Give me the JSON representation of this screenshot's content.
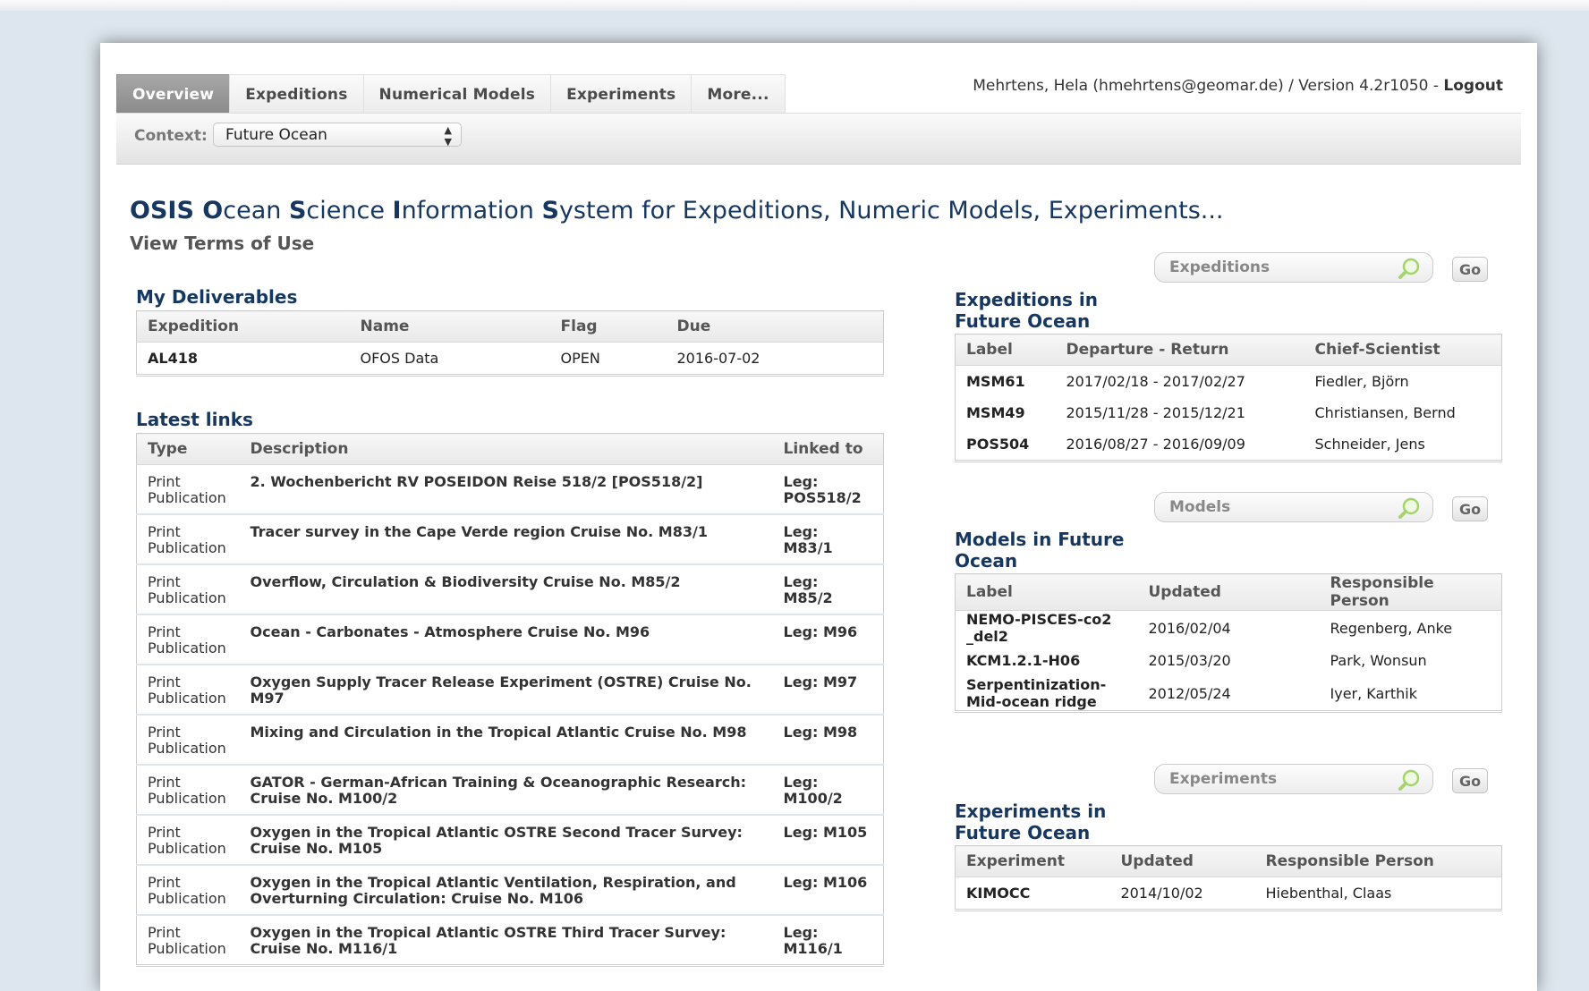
{
  "tabs": [
    "Overview",
    "Expeditions",
    "Numerical Models",
    "Experiments",
    "More..."
  ],
  "active_tab": "Overview",
  "user_info": {
    "text": "Mehrtens, Hela (hmehrtens@geomar.de) / Version 4.2r1050 - ",
    "logout": "Logout"
  },
  "context": {
    "label": "Context:",
    "value": "Future Ocean"
  },
  "title": {
    "parts": [
      {
        "t": "O",
        "b": true
      },
      {
        "t": "SIS ",
        "b": true
      },
      {
        "t": "O",
        "b": true
      },
      {
        "t": "cean ",
        "b": false
      },
      {
        "t": "S",
        "b": true
      },
      {
        "t": "cience ",
        "b": false
      },
      {
        "t": "I",
        "b": true
      },
      {
        "t": "nformation ",
        "b": false
      },
      {
        "t": "S",
        "b": true
      },
      {
        "t": "ystem for Expeditions, Numeric Models, Experiments...",
        "b": false
      }
    ]
  },
  "terms_link": "View Terms of Use",
  "deliverables": {
    "title": "My Deliverables",
    "headers": [
      "Expedition",
      "Name",
      "Flag",
      "Due"
    ],
    "rows": [
      {
        "expedition": "AL418",
        "name": "OFOS Data",
        "flag": "OPEN",
        "due": "2016-07-02"
      }
    ]
  },
  "latest_links": {
    "title": "Latest links",
    "headers": [
      "Type",
      "Description",
      "Linked to"
    ],
    "rows": [
      {
        "type": "Print Publication",
        "desc": "2. Wochenbericht RV POSEIDON Reise 518/2 [POS518/2]",
        "leg": "Leg: POS518/2"
      },
      {
        "type": "Print Publication",
        "desc": "Tracer survey in the Cape Verde region Cruise No. M83/1",
        "leg": "Leg: M83/1"
      },
      {
        "type": "Print Publication",
        "desc": "Overflow, Circulation & Biodiversity Cruise No. M85/2",
        "leg": "Leg: M85/2"
      },
      {
        "type": "Print Publication",
        "desc": "Ocean - Carbonates - Atmosphere Cruise No. M96",
        "leg": "Leg: M96"
      },
      {
        "type": "Print Publication",
        "desc": "Oxygen Supply Tracer Release Experiment (OSTRE) Cruise No. M97",
        "leg": "Leg: M97"
      },
      {
        "type": "Print Publication",
        "desc": "Mixing and Circulation in the Tropical Atlantic Cruise No. M98",
        "leg": "Leg: M98"
      },
      {
        "type": "Print Publication",
        "desc": "GATOR - German-African Training & Oceanographic Research: Cruise No. M100/2",
        "leg": "Leg: M100/2"
      },
      {
        "type": "Print Publication",
        "desc": "Oxygen in the Tropical Atlantic OSTRE Second Tracer Survey: Cruise No. M105",
        "leg": "Leg: M105"
      },
      {
        "type": "Print Publication",
        "desc": "Oxygen in the Tropical Atlantic Ventilation, Respiration, and Overturning Circulation: Cruise No. M106",
        "leg": "Leg: M106"
      },
      {
        "type": "Print Publication",
        "desc": "Oxygen in the Tropical Atlantic OSTRE Third Tracer Survey: Cruise No. M116/1",
        "leg": "Leg: M116/1"
      }
    ]
  },
  "search": {
    "expeditions_placeholder": "Expeditions",
    "models_placeholder": "Models",
    "experiments_placeholder": "Experiments",
    "go_label": "Go"
  },
  "expeditions": {
    "title_line1": "Expeditions in",
    "title_line2": "Future Ocean",
    "headers": [
      "Label",
      "Departure - Return",
      "Chief-Scientist"
    ],
    "rows": [
      {
        "label": "MSM61",
        "dates": "2017/02/18 - 2017/02/27",
        "chief": "Fiedler, Björn"
      },
      {
        "label": "MSM49",
        "dates": "2015/11/28 - 2015/12/21",
        "chief": "Christiansen, Bernd"
      },
      {
        "label": "POS504",
        "dates": "2016/08/27 - 2016/09/09",
        "chief": "Schneider, Jens"
      }
    ]
  },
  "models": {
    "title_line1": "Models in Future",
    "title_line2": "Ocean",
    "headers": [
      "Label",
      "Updated",
      "Responsible Person"
    ],
    "rows": [
      {
        "label": "NEMO-PISCES-co2 _del2",
        "updated": "2016/02/04",
        "person": "Regenberg, Anke"
      },
      {
        "label": "KCM1.2.1-H06",
        "updated": "2015/03/20",
        "person": "Park, Wonsun"
      },
      {
        "label": "Serpentinization- Mid-ocean ridge",
        "updated": "2012/05/24",
        "person": "Iyer, Karthik"
      }
    ]
  },
  "experiments": {
    "title_line1": "Experiments in",
    "title_line2": "Future Ocean",
    "headers": [
      "Experiment",
      "Updated",
      "Responsible Person"
    ],
    "rows": [
      {
        "label": "KIMOCC",
        "updated": "2014/10/02",
        "person": "Hiebenthal, Claas"
      }
    ]
  }
}
